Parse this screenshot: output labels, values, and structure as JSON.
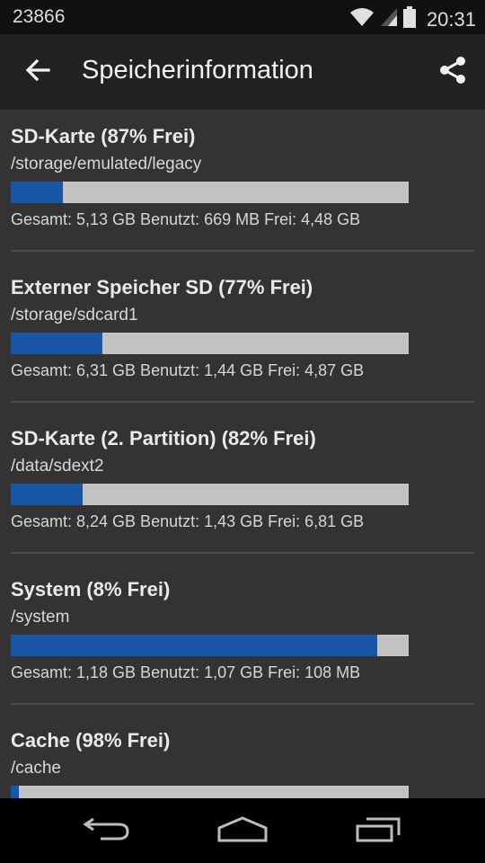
{
  "status_bar": {
    "left_text": "23866",
    "time": "20:31",
    "icons": [
      "wifi-icon",
      "signal-icon",
      "battery-icon"
    ]
  },
  "app_bar": {
    "title": "Speicherinformation",
    "back_icon": "arrow-back-icon",
    "share_icon": "share-icon"
  },
  "storage_items": [
    {
      "title": "SD-Karte (87% Frei)",
      "path": "/storage/emulated/legacy",
      "used_fraction": 0.13,
      "stats": "Gesamt: 5,13 GB Benutzt: 669 MB Frei: 4,48 GB"
    },
    {
      "title": "Externer Speicher SD (77% Frei)",
      "path": "/storage/sdcard1",
      "used_fraction": 0.23,
      "stats": "Gesamt: 6,31 GB Benutzt: 1,44 GB Frei: 4,87 GB"
    },
    {
      "title": "SD-Karte (2. Partition) (82% Frei)",
      "path": "/data/sdext2",
      "used_fraction": 0.18,
      "stats": "Gesamt: 8,24 GB Benutzt: 1,43 GB Frei: 6,81 GB"
    },
    {
      "title": "System (8% Frei)",
      "path": "/system",
      "used_fraction": 0.92,
      "stats": "Gesamt: 1,18 GB Benutzt: 1,07 GB Frei: 108 MB"
    },
    {
      "title": "Cache (98% Frei)",
      "path": "/cache",
      "used_fraction": 0.02,
      "stats": ""
    }
  ],
  "colors": {
    "background": "#333333",
    "app_bar": "#222222",
    "status_bar": "#111111",
    "bar_used": "#1957a6",
    "bar_free": "#c2c2c2",
    "nav_bar": "#000000"
  },
  "nav_bar": {
    "icons": [
      "back-nav-icon",
      "home-nav-icon",
      "recents-nav-icon"
    ]
  }
}
